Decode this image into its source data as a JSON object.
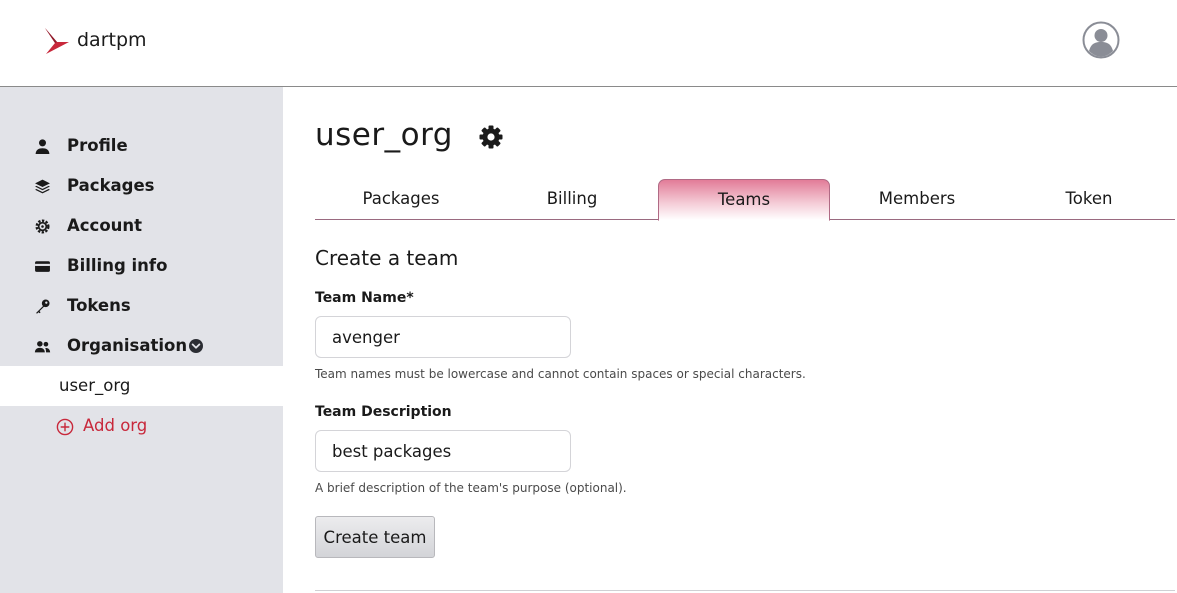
{
  "header": {
    "brand": "dartpm",
    "logo_icon": "dartpm-logo-icon",
    "avatar_icon": "user-avatar-icon"
  },
  "sidebar": {
    "items": [
      {
        "label": "Profile",
        "icon": "person-icon"
      },
      {
        "label": "Packages",
        "icon": "stack-icon"
      },
      {
        "label": "Account",
        "icon": "gear-icon"
      },
      {
        "label": "Billing info",
        "icon": "credit-card-icon"
      },
      {
        "label": "Tokens",
        "icon": "key-icon"
      },
      {
        "label": "Organisation",
        "icon": "people-icon",
        "expanded": true
      }
    ],
    "org_items": [
      {
        "label": "user_org",
        "active": true
      }
    ],
    "add_org_label": "Add org"
  },
  "main": {
    "org_name": "user_org",
    "tabs": [
      {
        "label": "Packages",
        "active": false
      },
      {
        "label": "Billing",
        "active": false
      },
      {
        "label": "Teams",
        "active": true
      },
      {
        "label": "Members",
        "active": false
      },
      {
        "label": "Token",
        "active": false
      }
    ],
    "form": {
      "title": "Create a team",
      "team_name_label": "Team Name*",
      "team_name_value": "avenger",
      "team_name_help": "Team names must be lowercase and cannot contain spaces or special characters.",
      "team_description_label": "Team Description",
      "team_description_value": "best packages",
      "team_description_help": "A brief description of the team's purpose (optional).",
      "submit_label": "Create team"
    }
  },
  "colors": {
    "accent": "#c8283b",
    "tab_active_top": "#e27c98",
    "sidebar_bg": "#e2e3e8"
  }
}
